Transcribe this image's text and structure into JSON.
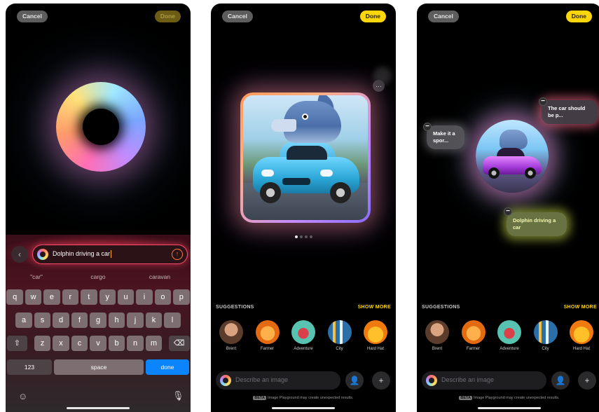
{
  "top": {
    "cancel": "Cancel",
    "done": "Done"
  },
  "phone1": {
    "prompt": "Dolphin driving a car",
    "suggestions": [
      "\"car\"",
      "cargo",
      "caravan"
    ],
    "keys_row1": [
      "q",
      "w",
      "e",
      "r",
      "t",
      "y",
      "u",
      "i",
      "o",
      "p"
    ],
    "keys_row2": [
      "a",
      "s",
      "d",
      "f",
      "g",
      "h",
      "j",
      "k",
      "l"
    ],
    "keys_row3": [
      "z",
      "x",
      "c",
      "v",
      "b",
      "n",
      "m"
    ],
    "key_numbers": "123",
    "key_space": "space",
    "key_done": "done"
  },
  "suggestions_header": "SUGGESTIONS",
  "show_more": "SHOW MORE",
  "suggestion_items": [
    {
      "label": "Brent"
    },
    {
      "label": "Farmer"
    },
    {
      "label": "Adventure"
    },
    {
      "label": "City"
    },
    {
      "label": "Hard Hat"
    }
  ],
  "describe_placeholder": "Describe an image",
  "beta_badge": "BETA",
  "beta_note": "Image Playground may create unexpected results.",
  "phone2": {
    "page_count": 4,
    "active_page": 1
  },
  "phone3": {
    "bubble_car": "The car should be p...",
    "bubble_make": "Make it a spor...",
    "bubble_dolphin": "Dolphin driving a car"
  },
  "colors": {
    "accent_yellow": "#ffd60a",
    "keyboard_blue": "#0a84ff",
    "prompt_border": "#ff4a6a"
  },
  "icons": {
    "back": "chevron-left-icon",
    "send": "arrow-up-icon",
    "shift": "shift-icon",
    "delete": "delete-icon",
    "emoji": "emoji-icon",
    "mic": "mic-icon",
    "more": "ellipsis-icon",
    "person": "person-icon",
    "add": "plus-icon",
    "remove": "minus-icon"
  }
}
